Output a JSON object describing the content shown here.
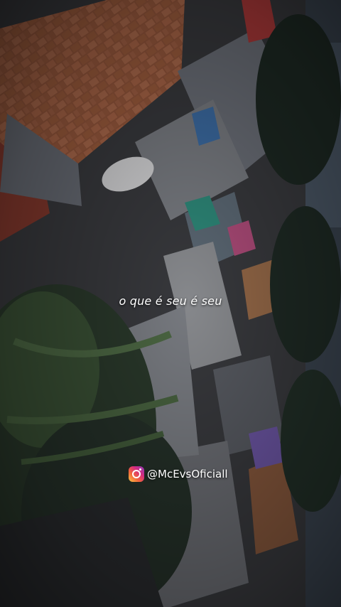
{
  "video": {
    "lyric_caption": "o que é seu é seu",
    "instagram_handle": "@McEvsOficiall",
    "instagram_icon": "instagram-icon"
  }
}
